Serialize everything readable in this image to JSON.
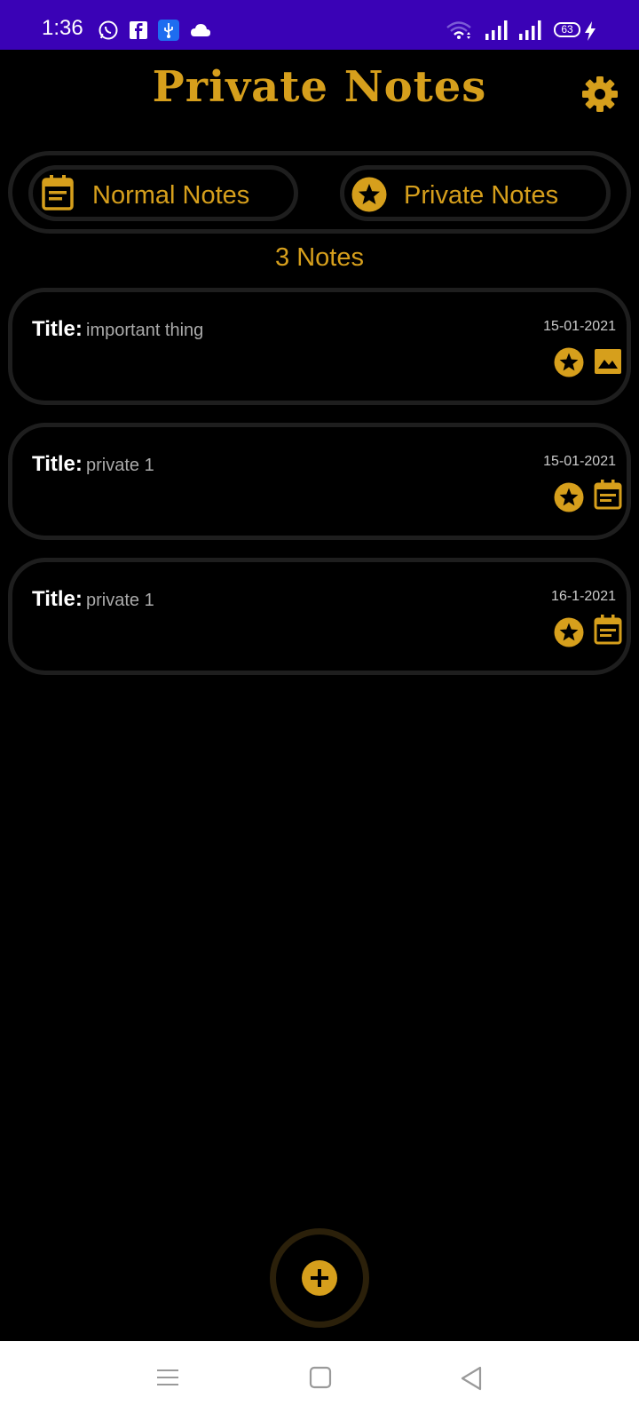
{
  "colors": {
    "statusbar": "#3a02b6",
    "accent": "#d69f1c",
    "card_border": "#1e1e1e",
    "background": "#000000"
  },
  "statusbar": {
    "time": "1:36",
    "battery": "63",
    "left_icons": [
      "whatsapp-icon",
      "facebook-icon",
      "usb-icon",
      "cloud-icon"
    ],
    "right_icons": [
      "wifi-icon",
      "signal-icon",
      "signal-icon",
      "battery-icon",
      "charging-icon"
    ]
  },
  "header": {
    "title": "Private Notes",
    "settings_icon": "gear-icon"
  },
  "tabs": [
    {
      "label": "Normal Notes",
      "icon": "calendar-note-icon",
      "selected": false
    },
    {
      "label": "Private Notes",
      "icon": "star-icon",
      "selected": true
    }
  ],
  "notes_count": "3 Notes",
  "notes": [
    {
      "title_label": "Title:",
      "title": "important thing",
      "date": "15-01-2021",
      "type_icon": "image-icon"
    },
    {
      "title_label": "Title:",
      "title": "private 1",
      "date": "15-01-2021",
      "type_icon": "calendar-note-icon"
    },
    {
      "title_label": "Title:",
      "title": "private 1",
      "date": "16-1-2021",
      "type_icon": "calendar-note-icon"
    }
  ],
  "fab": {
    "icon": "plus-icon"
  },
  "navbar": {
    "icons": [
      "menu-icon",
      "home-square-icon",
      "back-triangle-icon"
    ]
  }
}
